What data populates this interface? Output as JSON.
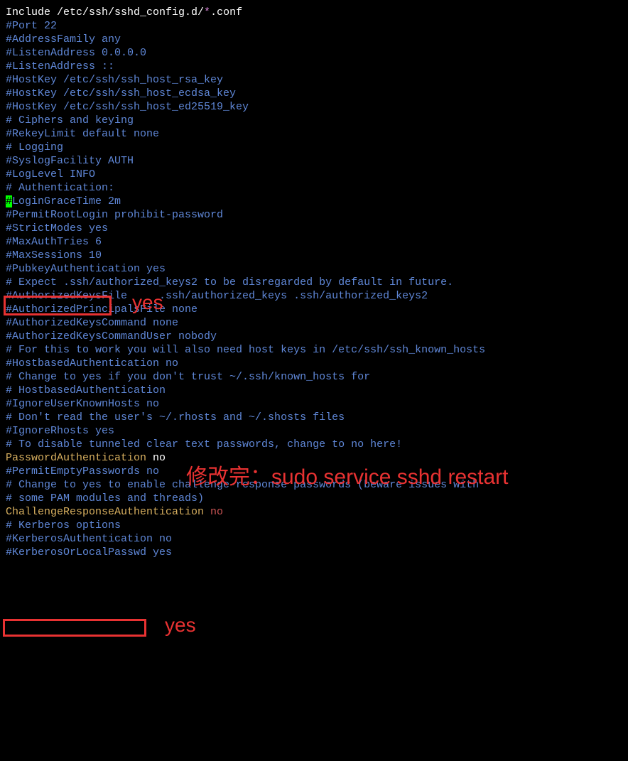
{
  "lines": {
    "l0": "",
    "l1_a": "Include /etc/ssh/sshd_config.d/",
    "l1_b": "*",
    "l1_c": ".conf",
    "l2": "",
    "l3": "#Port 22",
    "l4": "#AddressFamily any",
    "l5": "#ListenAddress 0.0.0.0",
    "l6": "#ListenAddress ::",
    "l7": "",
    "l8": "#HostKey /etc/ssh/ssh_host_rsa_key",
    "l9": "#HostKey /etc/ssh/ssh_host_ecdsa_key",
    "l10": "#HostKey /etc/ssh/ssh_host_ed25519_key",
    "l11": "",
    "l12": "# Ciphers and keying",
    "l13": "#RekeyLimit default none",
    "l14": "",
    "l15": "# Logging",
    "l16": "#SyslogFacility AUTH",
    "l17": "#LogLevel INFO",
    "l18": "",
    "l19": "# Authentication:",
    "l20": "",
    "l21_a": "#",
    "l21_b": "LoginGraceTime 2m",
    "l22": "#PermitRootLogin prohibit-password",
    "l23": "#StrictModes yes",
    "l24": "#MaxAuthTries 6",
    "l25": "#MaxSessions 10",
    "l26": "",
    "l27": "#PubkeyAuthentication yes",
    "l28": "",
    "l29": "# Expect .ssh/authorized_keys2 to be disregarded by default in future.",
    "l30": "#AuthorizedKeysFile     .ssh/authorized_keys .ssh/authorized_keys2",
    "l31": "",
    "l32": "#AuthorizedPrincipalsFile none",
    "l33": "",
    "l34": "#AuthorizedKeysCommand none",
    "l35": "#AuthorizedKeysCommandUser nobody",
    "l36": "",
    "l37": "# For this to work you will also need host keys in /etc/ssh/ssh_known_hosts",
    "l38": "#HostbasedAuthentication no",
    "l39": "# Change to yes if you don't trust ~/.ssh/known_hosts for",
    "l40": "# HostbasedAuthentication",
    "l41": "#IgnoreUserKnownHosts no",
    "l42": "# Don't read the user's ~/.rhosts and ~/.shosts files",
    "l43": "#IgnoreRhosts yes",
    "l44": "",
    "l45": "# To disable tunneled clear text passwords, change to no here!",
    "l46_a": "PasswordAuthentication",
    "l46_b": " no",
    "l47": "#PermitEmptyPasswords no",
    "l48": "",
    "l49": "# Change to yes to enable challenge-response passwords (beware issues with",
    "l50": "# some PAM modules and threads)",
    "l51_a": "ChallengeResponseAuthentication ",
    "l51_b": "no",
    "l52": "",
    "l53": "# Kerberos options",
    "l54": "#KerberosAuthentication no",
    "l55": "#KerberosOrLocalPasswd yes"
  },
  "annotations": {
    "yes1": "yes",
    "yes2": "yes",
    "restart": "修改完：sudo service sshd restart"
  }
}
